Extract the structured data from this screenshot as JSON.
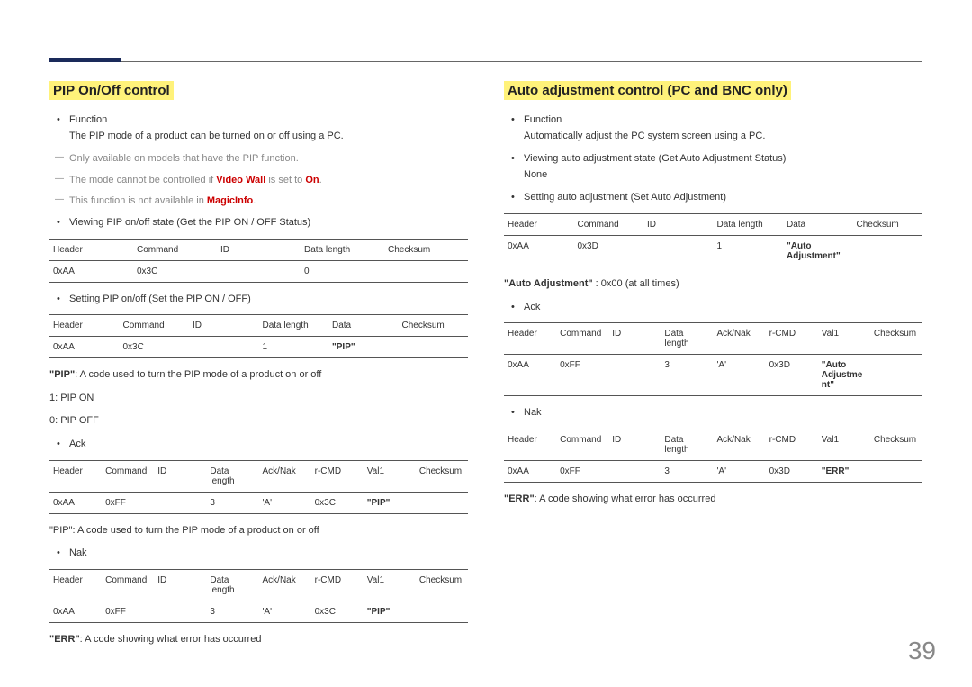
{
  "page_number": "39",
  "left": {
    "title": "PIP On/Off control",
    "func_label": "Function",
    "func_desc": "The PIP mode of a product can be turned on or off using a PC.",
    "note1": "Only available on models that have the PIP function.",
    "note2_a": "The mode cannot be controlled if ",
    "note2_b": "Video Wall",
    "note2_c": " is set to ",
    "note2_d": "On",
    "note2_e": ".",
    "note3_a": "This function is not available in ",
    "note3_b": "MagicInfo",
    "note3_c": ".",
    "view_label": "Viewing PIP on/off state (Get the PIP ON / OFF Status)",
    "t1": {
      "h": [
        "Header",
        "Command",
        "ID",
        "Data length",
        "Checksum"
      ],
      "r": [
        "0xAA",
        "0x3C",
        "",
        "0",
        ""
      ]
    },
    "set_label": "Setting PIP on/off (Set the PIP ON / OFF)",
    "t2": {
      "h": [
        "Header",
        "Command",
        "ID",
        "Data length",
        "Data",
        "Checksum"
      ],
      "r": [
        "0xAA",
        "0x3C",
        "",
        "1",
        "\"PIP\"",
        ""
      ]
    },
    "pip_expl_a": "\"PIP\"",
    "pip_expl_b": ": A code used to turn the PIP mode of a product on or off",
    "pip_on": "1: PIP ON",
    "pip_off": "0: PIP OFF",
    "ack_label": "Ack",
    "t3": {
      "h": [
        "Header",
        "Command",
        "ID",
        "Data length",
        "Ack/Nak",
        "r-CMD",
        "Val1",
        "Checksum"
      ],
      "r": [
        "0xAA",
        "0xFF",
        "",
        "3",
        "'A'",
        "0x3C",
        "\"PIP\"",
        ""
      ]
    },
    "pip2_expl": "\"PIP\": A code used to turn the PIP mode of a product on or off",
    "nak_label": "Nak",
    "t4": {
      "h": [
        "Header",
        "Command",
        "ID",
        "Data length",
        "Ack/Nak",
        "r-CMD",
        "Val1",
        "Checksum"
      ],
      "r": [
        "0xAA",
        "0xFF",
        "",
        "3",
        "'A'",
        "0x3C",
        "\"PIP\"",
        ""
      ]
    },
    "err_a": "\"ERR\"",
    "err_b": ": A code showing what error has occurred"
  },
  "right": {
    "title": "Auto adjustment control (PC and BNC only)",
    "func_label": "Function",
    "func_desc": "Automatically adjust the PC system screen using a PC.",
    "view_label": "Viewing auto adjustment state (Get Auto Adjustment Status)",
    "view_none": "None",
    "set_label": "Setting auto adjustment (Set Auto Adjustment)",
    "t1": {
      "h": [
        "Header",
        "Command",
        "ID",
        "Data length",
        "Data",
        "Checksum"
      ],
      "r": [
        "0xAA",
        "0x3D",
        "",
        "1",
        "\"Auto Adjustment\"",
        ""
      ]
    },
    "auto_a": "\"Auto Adjustment\"",
    "auto_b": " : 0x00 (at all times)",
    "ack_label": "Ack",
    "t2": {
      "h": [
        "Header",
        "Command",
        "ID",
        "Data length",
        "Ack/Nak",
        "r-CMD",
        "Val1",
        "Checksum"
      ],
      "r": [
        "0xAA",
        "0xFF",
        "",
        "3",
        "'A'",
        "0x3D",
        "\"Auto Adjustment\"",
        ""
      ]
    },
    "nak_label": "Nak",
    "t3": {
      "h": [
        "Header",
        "Command",
        "ID",
        "Data length",
        "Ack/Nak",
        "r-CMD",
        "Val1",
        "Checksum"
      ],
      "r": [
        "0xAA",
        "0xFF",
        "",
        "3",
        "'A'",
        "0x3D",
        "\"ERR\"",
        ""
      ]
    },
    "err_a": "\"ERR\"",
    "err_b": ": A code showing what error has occurred"
  }
}
